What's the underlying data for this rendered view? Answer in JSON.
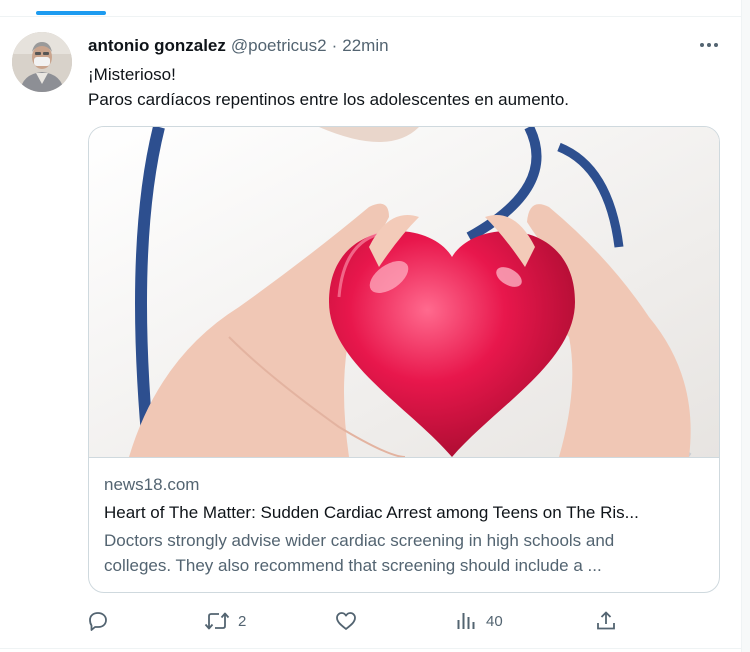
{
  "tweet": {
    "author_name": "antonio gonzalez",
    "handle": "@poetricus2",
    "separator": "·",
    "time": "22min",
    "text_lines": [
      "¡Misterioso!",
      "Paros cardíacos repentinos entre los adolescentes en aumento."
    ]
  },
  "card": {
    "image_icon": "heart-held-in-hands-photo",
    "domain": "news18.com",
    "title": "Heart of The Matter: Sudden Cardiac Arrest among Teens on The Ris...",
    "description_lines": [
      "Doctors strongly advise wider cardiac screening in high schools and",
      "colleges. They also recommend that screening should include a ..."
    ]
  },
  "actions": {
    "reply": {
      "icon": "reply-icon",
      "count": ""
    },
    "retweet": {
      "icon": "retweet-icon",
      "count": "2"
    },
    "like": {
      "icon": "heart-icon",
      "count": ""
    },
    "views": {
      "icon": "views-icon",
      "count": "40"
    },
    "share": {
      "icon": "share-icon",
      "count": ""
    }
  },
  "colors": {
    "accent": "#1d9bf0",
    "primary_text": "#0f1419",
    "secondary_text": "#536471",
    "border": "#cfd9de"
  }
}
